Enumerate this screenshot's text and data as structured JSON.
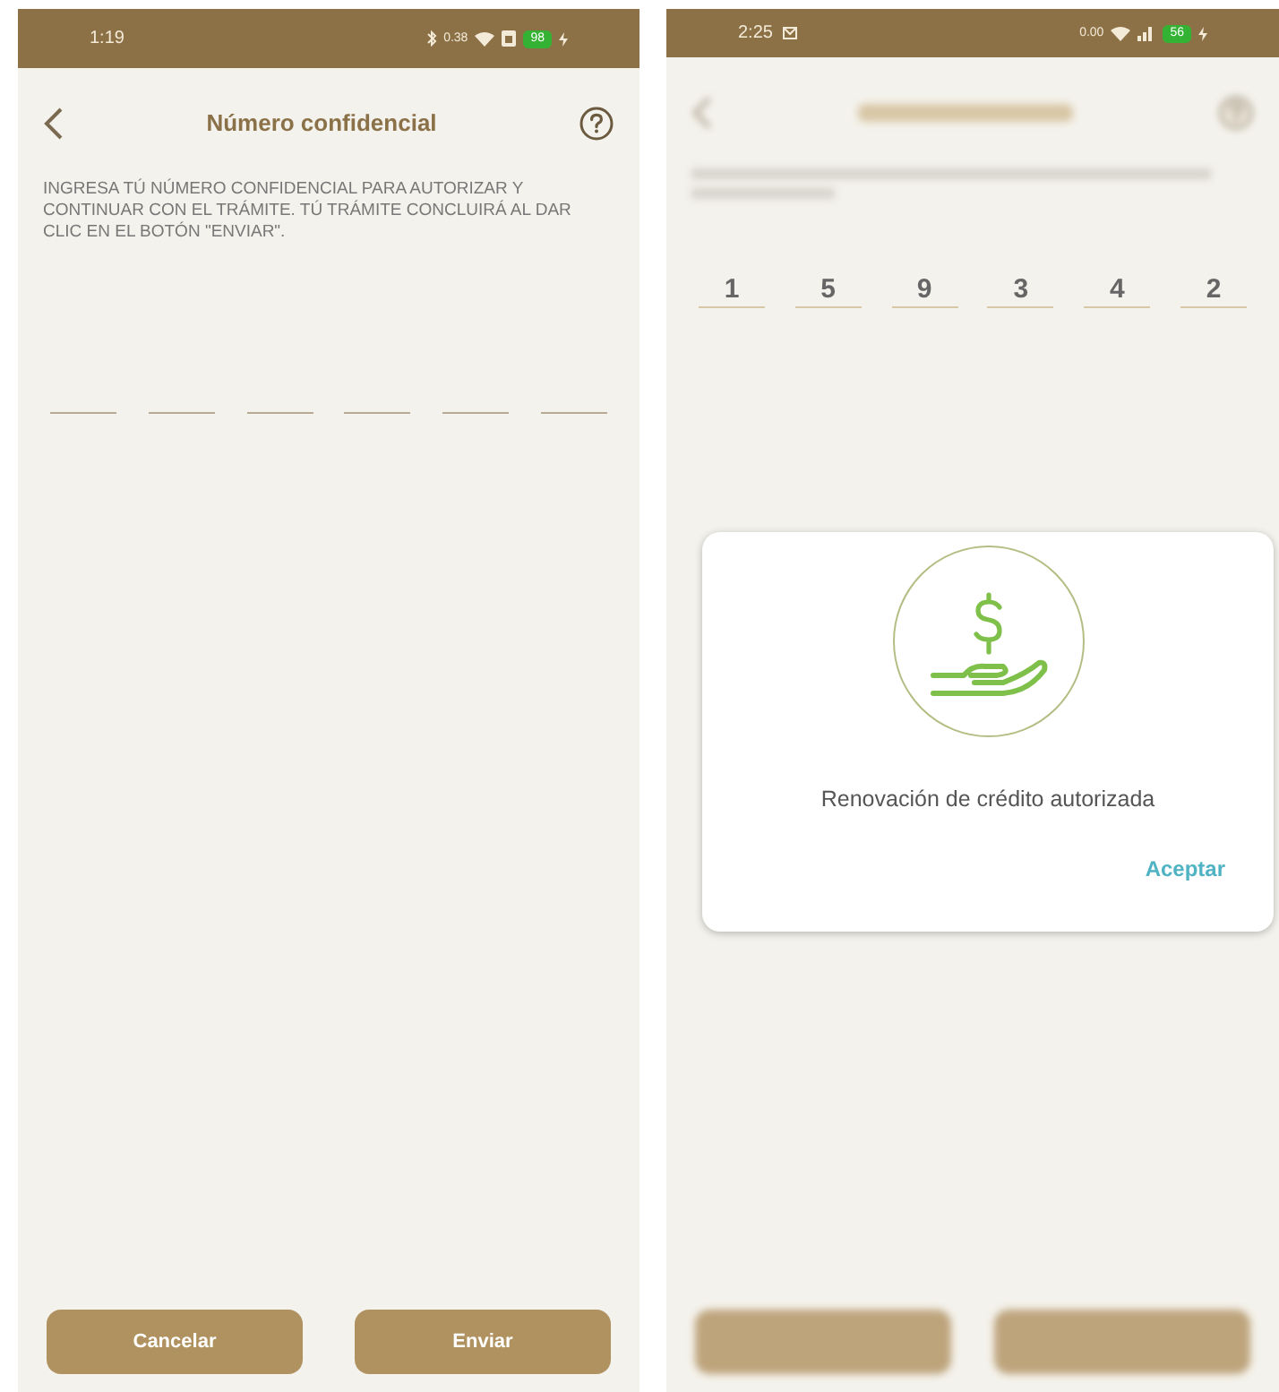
{
  "screens": [
    {
      "blurred": false,
      "status_bar": {
        "time": "1:19",
        "network_speed": "0.38",
        "battery": "98",
        "signal": false
      },
      "header": {
        "title": "Número confidencial"
      },
      "instructions": "INGRESA TÚ NÚMERO CONFIDENCIAL PARA AUTORIZAR Y CONTINUAR CON EL TRÁMITE. TÚ TRÁMITE CONCLUIRÁ AL DAR CLIC EN EL BOTÓN \"ENVIAR\".",
      "pin_slots": [
        {
          "filled": false
        },
        {
          "filled": false
        },
        {
          "filled": false
        },
        {
          "filled": false
        },
        {
          "filled": false
        },
        {
          "filled": false
        }
      ],
      "buttons": [
        {
          "label": "Cancelar",
          "blurred": false
        },
        {
          "label": "Enviar",
          "blurred": false
        }
      ]
    },
    {
      "blurred": true,
      "status_bar": {
        "time": "2:25",
        "network_speed": "0.00",
        "battery": "56",
        "signal": true
      },
      "pin_slots": [
        {
          "filled": true,
          "digit": "1"
        },
        {
          "filled": true,
          "digit": "5"
        },
        {
          "filled": true,
          "digit": "9"
        },
        {
          "filled": true,
          "digit": "3"
        },
        {
          "filled": true,
          "digit": "4"
        },
        {
          "filled": true,
          "digit": "2"
        }
      ],
      "buttons": [
        {
          "blurred": true
        },
        {
          "blurred": true
        }
      ],
      "dialog": {
        "message": "Renovación de crédito autorizada",
        "action": "Aceptar"
      }
    }
  ]
}
